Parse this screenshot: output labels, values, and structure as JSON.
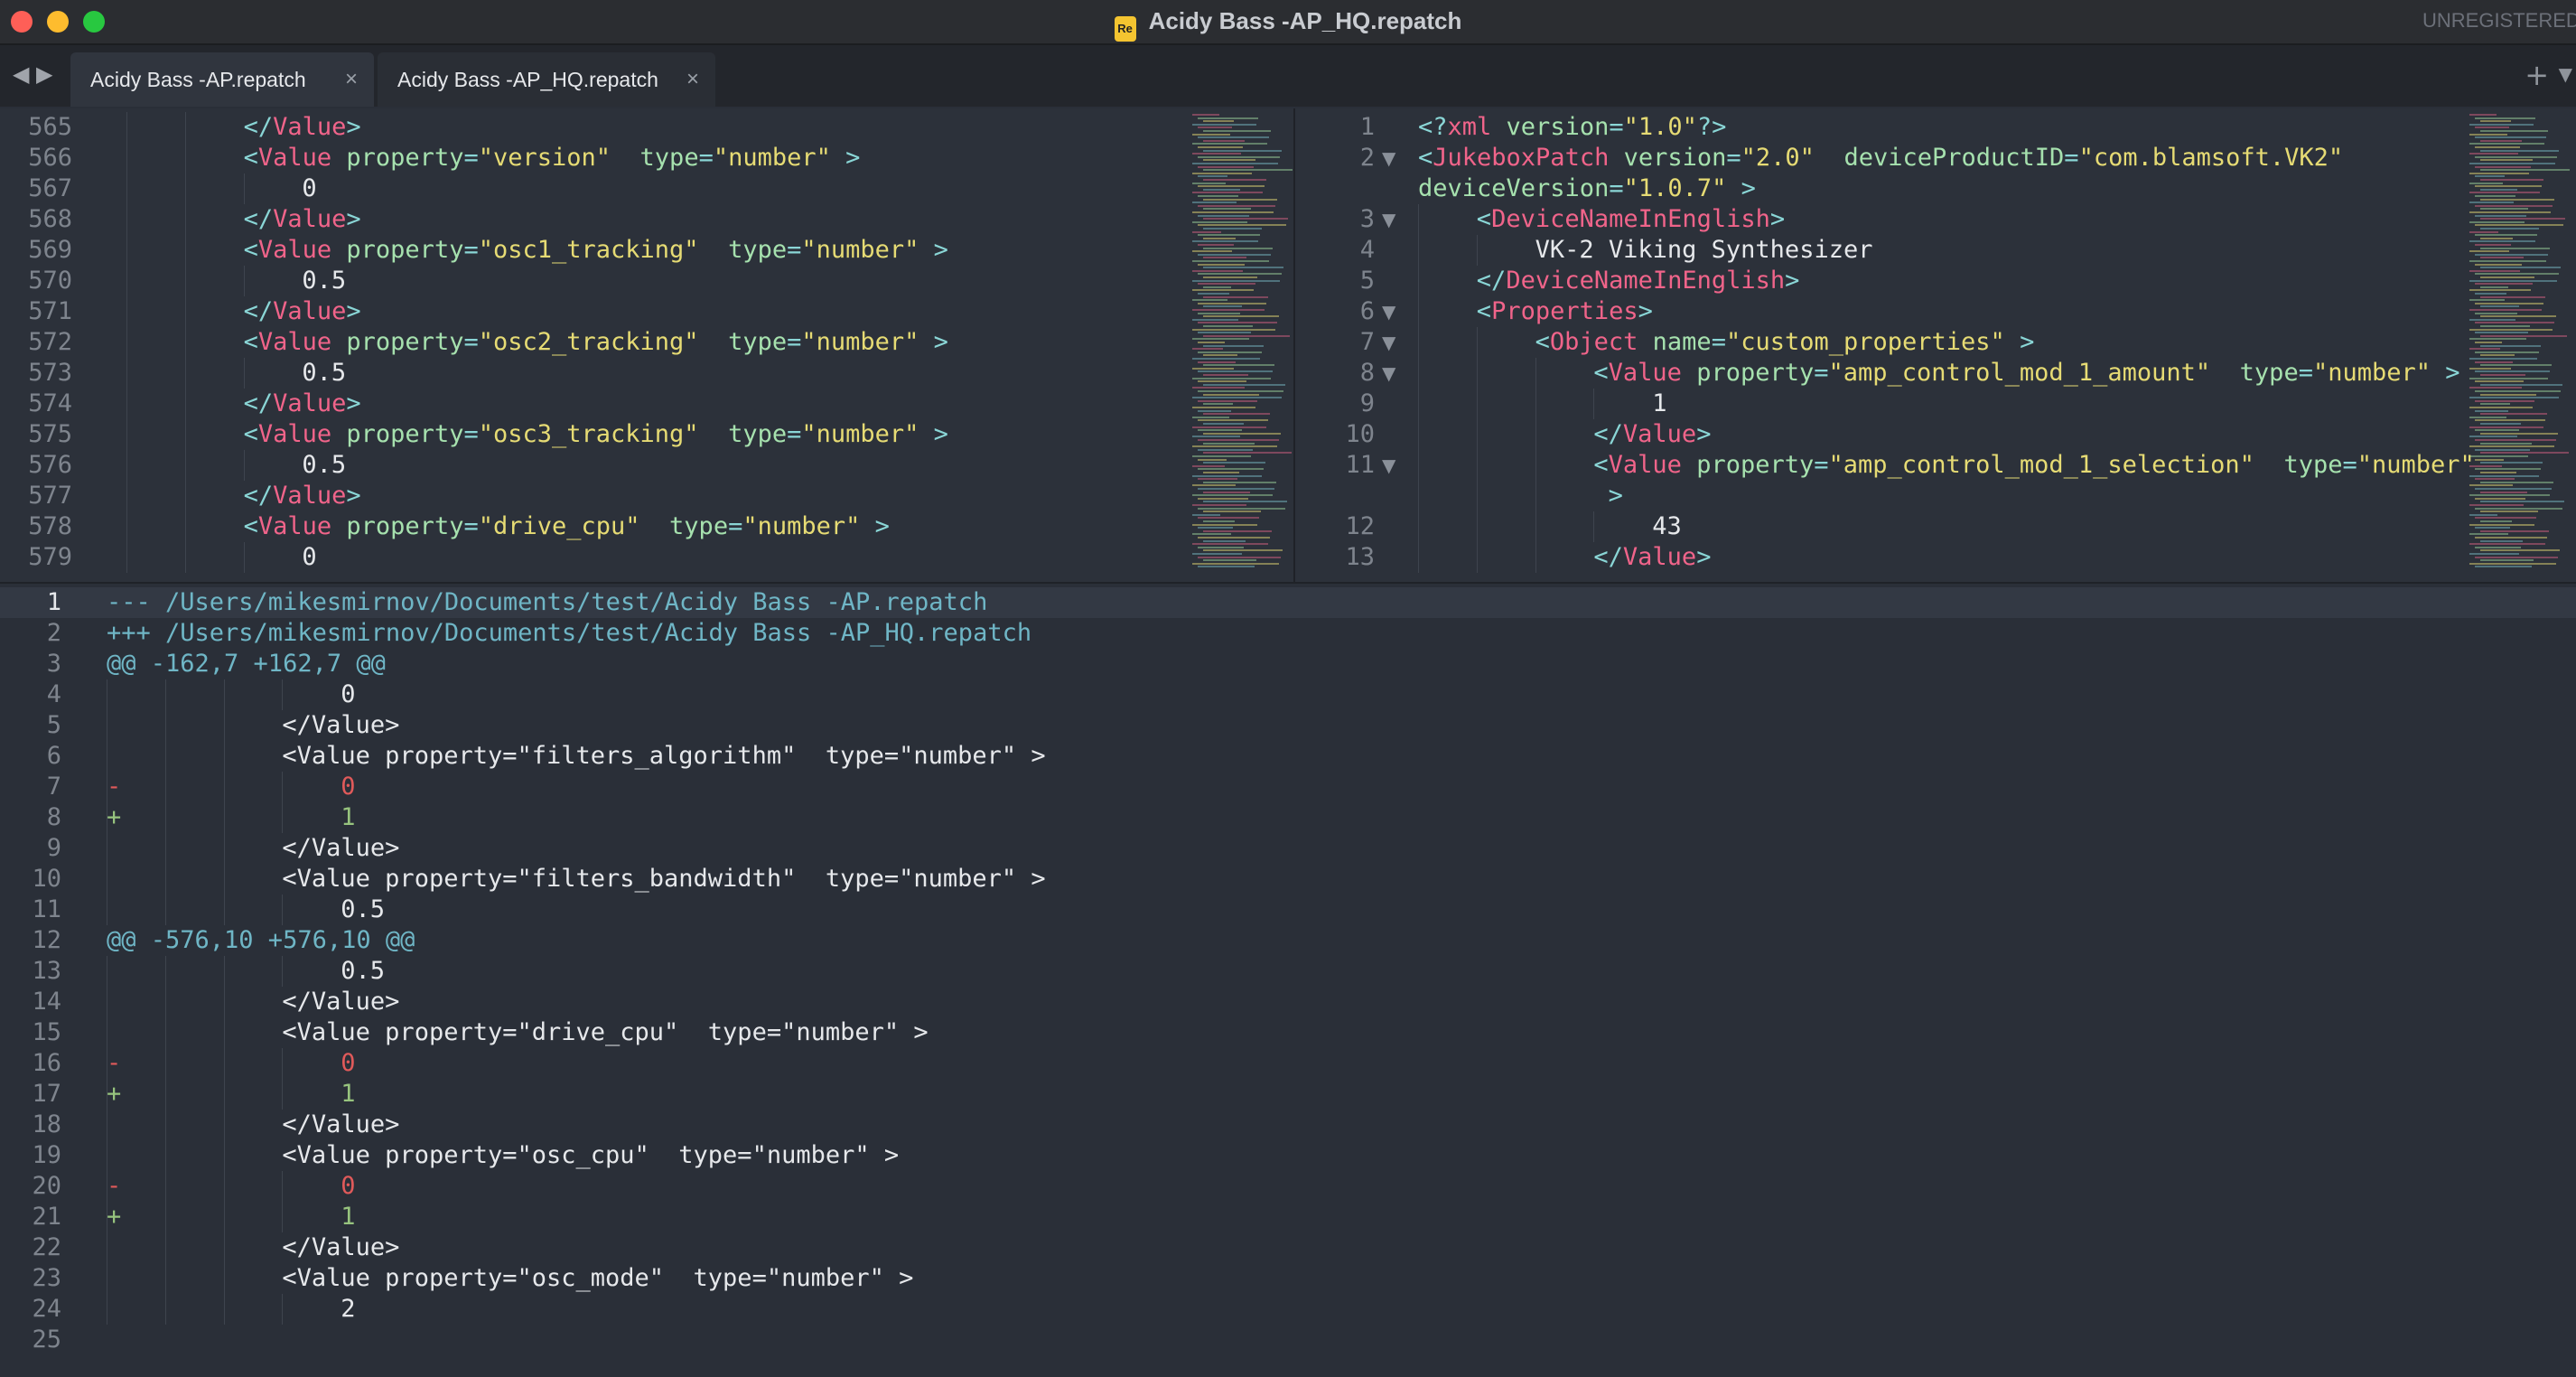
{
  "window": {
    "title": "Acidy Bass -AP_HQ.repatch",
    "registration": "UNREGISTERED"
  },
  "tabs": [
    {
      "label": "Acidy Bass -AP.repatch",
      "close": "×"
    },
    {
      "label": "Acidy Bass -AP_HQ.repatch",
      "close": "×"
    }
  ],
  "left_pane": {
    "lines": [
      {
        "n": "565",
        "indent": 2,
        "parts": [
          [
            "punct",
            "</"
          ],
          [
            "tag",
            "Value"
          ],
          [
            "punct",
            ">"
          ]
        ]
      },
      {
        "n": "566",
        "indent": 2,
        "parts": [
          [
            "punct",
            "<"
          ],
          [
            "tag",
            "Value "
          ],
          [
            "attr",
            "property"
          ],
          [
            "punct",
            "="
          ],
          [
            "str",
            "\"version\""
          ],
          [
            "txt",
            "  "
          ],
          [
            "attr",
            "type"
          ],
          [
            "punct",
            "="
          ],
          [
            "str",
            "\"number\""
          ],
          [
            "punct",
            " >"
          ]
        ]
      },
      {
        "n": "567",
        "indent": 3,
        "parts": [
          [
            "txt",
            "0"
          ]
        ]
      },
      {
        "n": "568",
        "indent": 2,
        "parts": [
          [
            "punct",
            "</"
          ],
          [
            "tag",
            "Value"
          ],
          [
            "punct",
            ">"
          ]
        ]
      },
      {
        "n": "569",
        "indent": 2,
        "parts": [
          [
            "punct",
            "<"
          ],
          [
            "tag",
            "Value "
          ],
          [
            "attr",
            "property"
          ],
          [
            "punct",
            "="
          ],
          [
            "str",
            "\"osc1_tracking\""
          ],
          [
            "txt",
            "  "
          ],
          [
            "attr",
            "type"
          ],
          [
            "punct",
            "="
          ],
          [
            "str",
            "\"number\""
          ],
          [
            "punct",
            " >"
          ]
        ]
      },
      {
        "n": "570",
        "indent": 3,
        "parts": [
          [
            "txt",
            "0.5"
          ]
        ]
      },
      {
        "n": "571",
        "indent": 2,
        "parts": [
          [
            "punct",
            "</"
          ],
          [
            "tag",
            "Value"
          ],
          [
            "punct",
            ">"
          ]
        ]
      },
      {
        "n": "572",
        "indent": 2,
        "parts": [
          [
            "punct",
            "<"
          ],
          [
            "tag",
            "Value "
          ],
          [
            "attr",
            "property"
          ],
          [
            "punct",
            "="
          ],
          [
            "str",
            "\"osc2_tracking\""
          ],
          [
            "txt",
            "  "
          ],
          [
            "attr",
            "type"
          ],
          [
            "punct",
            "="
          ],
          [
            "str",
            "\"number\""
          ],
          [
            "punct",
            " >"
          ]
        ]
      },
      {
        "n": "573",
        "indent": 3,
        "parts": [
          [
            "txt",
            "0.5"
          ]
        ]
      },
      {
        "n": "574",
        "indent": 2,
        "parts": [
          [
            "punct",
            "</"
          ],
          [
            "tag",
            "Value"
          ],
          [
            "punct",
            ">"
          ]
        ]
      },
      {
        "n": "575",
        "indent": 2,
        "parts": [
          [
            "punct",
            "<"
          ],
          [
            "tag",
            "Value "
          ],
          [
            "attr",
            "property"
          ],
          [
            "punct",
            "="
          ],
          [
            "str",
            "\"osc3_tracking\""
          ],
          [
            "txt",
            "  "
          ],
          [
            "attr",
            "type"
          ],
          [
            "punct",
            "="
          ],
          [
            "str",
            "\"number\""
          ],
          [
            "punct",
            " >"
          ]
        ]
      },
      {
        "n": "576",
        "indent": 3,
        "parts": [
          [
            "txt",
            "0.5"
          ]
        ]
      },
      {
        "n": "577",
        "indent": 2,
        "parts": [
          [
            "punct",
            "</"
          ],
          [
            "tag",
            "Value"
          ],
          [
            "punct",
            ">"
          ]
        ]
      },
      {
        "n": "578",
        "indent": 2,
        "parts": [
          [
            "punct",
            "<"
          ],
          [
            "tag",
            "Value "
          ],
          [
            "attr",
            "property"
          ],
          [
            "punct",
            "="
          ],
          [
            "str",
            "\"drive_cpu\""
          ],
          [
            "txt",
            "  "
          ],
          [
            "attr",
            "type"
          ],
          [
            "punct",
            "="
          ],
          [
            "str",
            "\"number\""
          ],
          [
            "punct",
            " >"
          ]
        ]
      },
      {
        "n": "579",
        "indent": 3,
        "parts": [
          [
            "txt",
            "0"
          ]
        ]
      }
    ]
  },
  "right_pane": {
    "lines": [
      {
        "n": "1",
        "fold": false,
        "indent": 0,
        "parts": [
          [
            "punct",
            "<?"
          ],
          [
            "pi",
            "xml "
          ],
          [
            "attr",
            "version"
          ],
          [
            "punct",
            "="
          ],
          [
            "str",
            "\"1.0\""
          ],
          [
            "punct",
            "?>"
          ]
        ]
      },
      {
        "n": "2",
        "fold": true,
        "indent": 0,
        "parts": [
          [
            "punct",
            "<"
          ],
          [
            "tag",
            "JukeboxPatch "
          ],
          [
            "attr",
            "version"
          ],
          [
            "punct",
            "="
          ],
          [
            "str",
            "\"2.0\""
          ],
          [
            "txt",
            "  "
          ],
          [
            "attr",
            "deviceProductID"
          ],
          [
            "punct",
            "="
          ],
          [
            "str",
            "\"com.blamsoft.VK2\""
          ]
        ]
      },
      {
        "n": "",
        "fold": false,
        "indent": 0,
        "parts": [
          [
            "attr",
            "deviceVersion"
          ],
          [
            "punct",
            "="
          ],
          [
            "str",
            "\"1.0.7\""
          ],
          [
            "punct",
            " >"
          ]
        ]
      },
      {
        "n": "3",
        "fold": true,
        "indent": 1,
        "parts": [
          [
            "punct",
            "<"
          ],
          [
            "tag",
            "DeviceNameInEnglish"
          ],
          [
            "punct",
            ">"
          ]
        ]
      },
      {
        "n": "4",
        "fold": false,
        "indent": 2,
        "parts": [
          [
            "txt",
            "VK-2 Viking Synthesizer"
          ]
        ]
      },
      {
        "n": "5",
        "fold": false,
        "indent": 1,
        "parts": [
          [
            "punct",
            "</"
          ],
          [
            "tag",
            "DeviceNameInEnglish"
          ],
          [
            "punct",
            ">"
          ]
        ]
      },
      {
        "n": "6",
        "fold": true,
        "indent": 1,
        "parts": [
          [
            "punct",
            "<"
          ],
          [
            "tag",
            "Properties"
          ],
          [
            "punct",
            ">"
          ]
        ]
      },
      {
        "n": "7",
        "fold": true,
        "indent": 2,
        "parts": [
          [
            "punct",
            "<"
          ],
          [
            "tag",
            "Object "
          ],
          [
            "attr",
            "name"
          ],
          [
            "punct",
            "="
          ],
          [
            "str",
            "\"custom_properties\""
          ],
          [
            "punct",
            " >"
          ]
        ]
      },
      {
        "n": "8",
        "fold": true,
        "indent": 3,
        "parts": [
          [
            "punct",
            "<"
          ],
          [
            "tag",
            "Value "
          ],
          [
            "attr",
            "property"
          ],
          [
            "punct",
            "="
          ],
          [
            "str",
            "\"amp_control_mod_1_amount\""
          ],
          [
            "txt",
            "  "
          ],
          [
            "attr",
            "type"
          ],
          [
            "punct",
            "="
          ],
          [
            "str",
            "\"number\""
          ],
          [
            "punct",
            " >"
          ]
        ]
      },
      {
        "n": "9",
        "fold": false,
        "indent": 4,
        "parts": [
          [
            "txt",
            "1"
          ]
        ]
      },
      {
        "n": "10",
        "fold": false,
        "indent": 3,
        "parts": [
          [
            "punct",
            "</"
          ],
          [
            "tag",
            "Value"
          ],
          [
            "punct",
            ">"
          ]
        ]
      },
      {
        "n": "11",
        "fold": true,
        "indent": 3,
        "parts": [
          [
            "punct",
            "<"
          ],
          [
            "tag",
            "Value "
          ],
          [
            "attr",
            "property"
          ],
          [
            "punct",
            "="
          ],
          [
            "str",
            "\"amp_control_mod_1_selection\""
          ],
          [
            "txt",
            "  "
          ],
          [
            "attr",
            "type"
          ],
          [
            "punct",
            "="
          ],
          [
            "str",
            "\"number\""
          ]
        ]
      },
      {
        "n": "",
        "fold": false,
        "indent": 3,
        "parts": [
          [
            "punct",
            " >"
          ]
        ]
      },
      {
        "n": "12",
        "fold": false,
        "indent": 4,
        "parts": [
          [
            "txt",
            "43"
          ]
        ]
      },
      {
        "n": "13",
        "fold": false,
        "indent": 3,
        "parts": [
          [
            "punct",
            "</"
          ],
          [
            "tag",
            "Value"
          ],
          [
            "punct",
            ">"
          ]
        ]
      }
    ]
  },
  "diff_pane": {
    "lines": [
      {
        "n": "1",
        "kind": "hdr",
        "mark": "",
        "indent": 0,
        "text": "--- /Users/mikesmirnov/Documents/test/Acidy Bass -AP.repatch"
      },
      {
        "n": "2",
        "kind": "hdr",
        "mark": "",
        "indent": 0,
        "text": "+++ /Users/mikesmirnov/Documents/test/Acidy Bass -AP_HQ.repatch"
      },
      {
        "n": "3",
        "kind": "hunk",
        "mark": "",
        "indent": 0,
        "text": "@@ -162,7 +162,7 @@"
      },
      {
        "n": "4",
        "kind": "plain",
        "mark": "",
        "indent": 4,
        "text": "0"
      },
      {
        "n": "5",
        "kind": "plain",
        "mark": "",
        "indent": 3,
        "text": "</Value>"
      },
      {
        "n": "6",
        "kind": "plain",
        "mark": "",
        "indent": 3,
        "text": "<Value property=\"filters_algorithm\"  type=\"number\" >"
      },
      {
        "n": "7",
        "kind": "del",
        "mark": "-",
        "indent": 4,
        "text": "0"
      },
      {
        "n": "8",
        "kind": "add",
        "mark": "+",
        "indent": 4,
        "text": "1"
      },
      {
        "n": "9",
        "kind": "plain",
        "mark": "",
        "indent": 3,
        "text": "</Value>"
      },
      {
        "n": "10",
        "kind": "plain",
        "mark": "",
        "indent": 3,
        "text": "<Value property=\"filters_bandwidth\"  type=\"number\" >"
      },
      {
        "n": "11",
        "kind": "plain",
        "mark": "",
        "indent": 4,
        "text": "0.5"
      },
      {
        "n": "12",
        "kind": "hunk",
        "mark": "",
        "indent": 0,
        "text": "@@ -576,10 +576,10 @@"
      },
      {
        "n": "13",
        "kind": "plain",
        "mark": "",
        "indent": 4,
        "text": "0.5"
      },
      {
        "n": "14",
        "kind": "plain",
        "mark": "",
        "indent": 3,
        "text": "</Value>"
      },
      {
        "n": "15",
        "kind": "plain",
        "mark": "",
        "indent": 3,
        "text": "<Value property=\"drive_cpu\"  type=\"number\" >"
      },
      {
        "n": "16",
        "kind": "del",
        "mark": "-",
        "indent": 4,
        "text": "0"
      },
      {
        "n": "17",
        "kind": "add",
        "mark": "+",
        "indent": 4,
        "text": "1"
      },
      {
        "n": "18",
        "kind": "plain",
        "mark": "",
        "indent": 3,
        "text": "</Value>"
      },
      {
        "n": "19",
        "kind": "plain",
        "mark": "",
        "indent": 3,
        "text": "<Value property=\"osc_cpu\"  type=\"number\" >"
      },
      {
        "n": "20",
        "kind": "del",
        "mark": "-",
        "indent": 4,
        "text": "0"
      },
      {
        "n": "21",
        "kind": "add",
        "mark": "+",
        "indent": 4,
        "text": "1"
      },
      {
        "n": "22",
        "kind": "plain",
        "mark": "",
        "indent": 3,
        "text": "</Value>"
      },
      {
        "n": "23",
        "kind": "plain",
        "mark": "",
        "indent": 3,
        "text": "<Value property=\"osc_mode\"  type=\"number\" >"
      },
      {
        "n": "24",
        "kind": "plain",
        "mark": "",
        "indent": 4,
        "text": "2"
      },
      {
        "n": "25",
        "kind": "plain",
        "mark": "",
        "indent": 0,
        "text": ""
      }
    ]
  }
}
